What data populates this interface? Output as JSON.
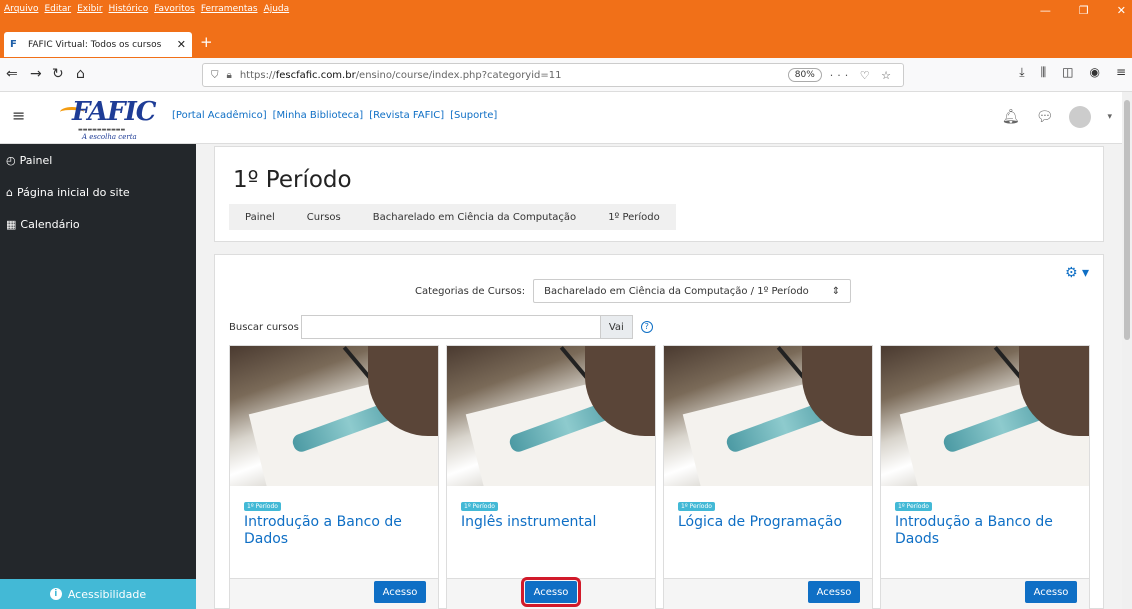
{
  "browser": {
    "menu": [
      "Arquivo",
      "Editar",
      "Exibir",
      "Histórico",
      "Favoritos",
      "Ferramentas",
      "Ajuda"
    ],
    "tab_title": "FAFIC Virtual: Todos os cursos",
    "url_prefix": "https://",
    "url_domain": "fescfafic.com.br",
    "url_path": "/ensino/course/index.php?categoryid=11",
    "zoom": "80%"
  },
  "header": {
    "logo_text": "FAFIC",
    "logo_tagline": "A escolha certa",
    "links": [
      "[Portal Acadêmico]",
      "[Minha Biblioteca]",
      "[Revista FAFIC]",
      "[Suporte]"
    ]
  },
  "sidebar": {
    "items": [
      {
        "label": "Painel"
      },
      {
        "label": "Página inicial do site"
      },
      {
        "label": "Calendário"
      }
    ],
    "accessibility": "Acessibilidade"
  },
  "page": {
    "title": "1º Período",
    "breadcrumb": [
      "Painel",
      "Cursos",
      "Bacharelado em Ciência da Computação",
      "1º Período"
    ]
  },
  "content": {
    "category_label": "Categorias de Cursos:",
    "category_value": "Bacharelado em Ciência da Computação / 1º Período",
    "search_label": "Buscar cursos",
    "search_button": "Vai",
    "courses": [
      {
        "badge": "1º Período",
        "name": "Introdução a Banco de Dados",
        "button": "Acesso"
      },
      {
        "badge": "1º Período",
        "name": "Inglês instrumental",
        "button": "Acesso"
      },
      {
        "badge": "1º Período",
        "name": "Lógica de Programação",
        "button": "Acesso"
      },
      {
        "badge": "1º Período",
        "name": "Introdução a Banco de Daods",
        "button": "Acesso"
      }
    ]
  },
  "colors": {
    "firefox_orange": "#f17018",
    "moodle_blue": "#0f6fc5",
    "sidebar_dark": "#23272b",
    "accent_cyan": "#43b9d6",
    "highlight_red": "#d11a2a"
  }
}
